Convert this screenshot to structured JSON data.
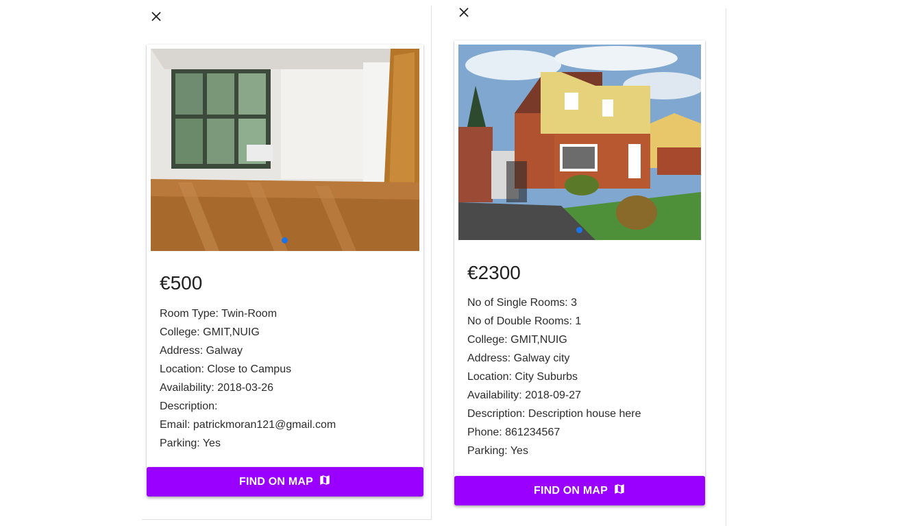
{
  "listings": [
    {
      "price": "€500",
      "details": [
        "Room Type: Twin-Room",
        "College: GMIT,NUIG",
        "Address: Galway",
        "Location: Close to Campus",
        "Availability: 2018-03-26",
        "Description:",
        "Email: patrickmoran121@gmail.com",
        "Parking: Yes"
      ],
      "button_label": "FIND ON MAP",
      "photo_icon": "room-interior-photo",
      "close_icon": "close-icon"
    },
    {
      "price": "€2300",
      "details": [
        "No of Single Rooms: 3",
        "No of Double Rooms: 1",
        "College: GMIT,NUIG",
        "Address: Galway city",
        "Location: City Suburbs",
        "Availability: 2018-09-27",
        "Description: Description house here",
        "Phone: 861234567",
        "Parking: Yes"
      ],
      "button_label": "FIND ON MAP",
      "photo_icon": "house-exterior-photo",
      "close_icon": "close-icon"
    }
  ],
  "colors": {
    "button": "#9900ff",
    "carousel_dot": "#1a73e8"
  }
}
